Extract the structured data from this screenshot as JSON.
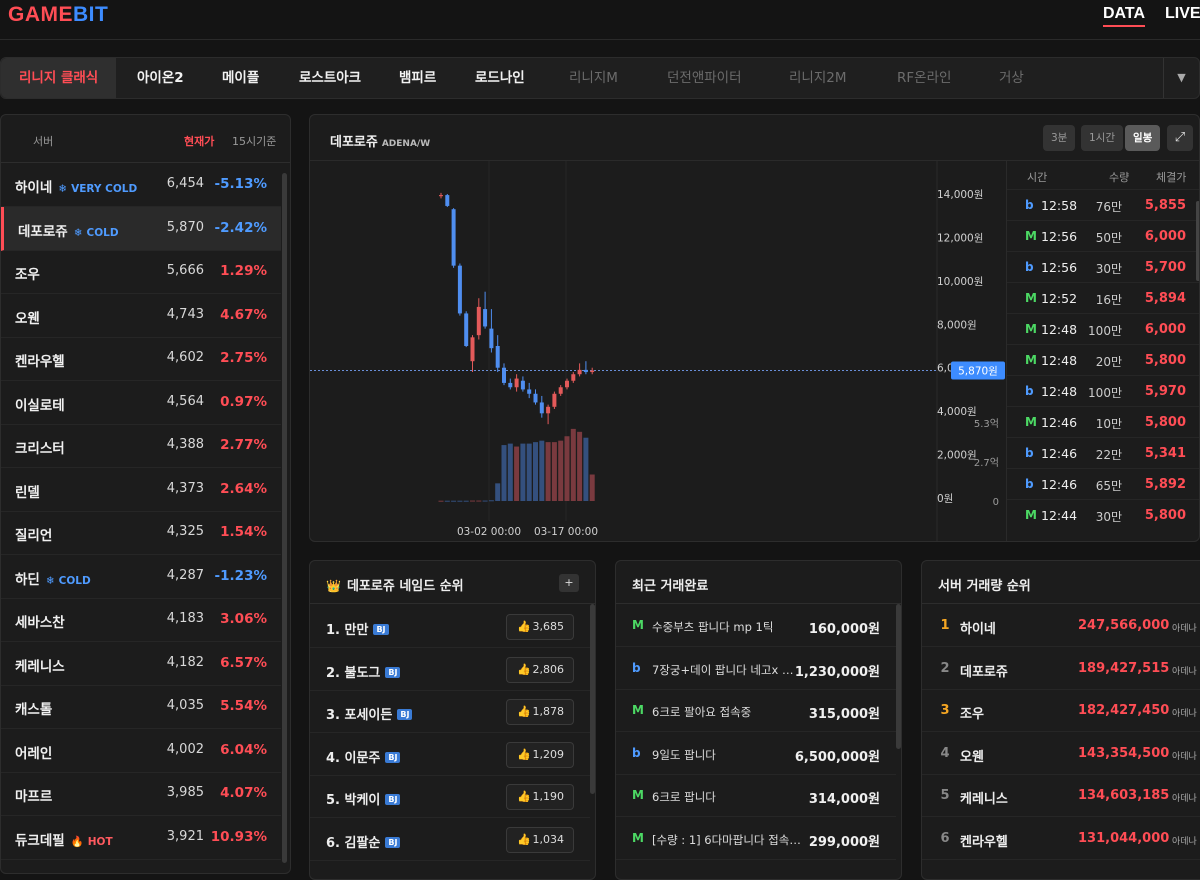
{
  "header": {
    "logo_part1": "GAME",
    "logo_part2": "BIT",
    "nav": [
      "DATA",
      "LIVE"
    ]
  },
  "game_tabs": {
    "items": [
      {
        "label": "리니지 클래식",
        "state": "active"
      },
      {
        "label": "아이온2",
        "state": "normal"
      },
      {
        "label": "메이플",
        "state": "normal"
      },
      {
        "label": "로스트아크",
        "state": "normal"
      },
      {
        "label": "뱀피르",
        "state": "normal"
      },
      {
        "label": "로드나인",
        "state": "normal"
      },
      {
        "label": "리니지M",
        "state": "dim"
      },
      {
        "label": "던전앤파이터",
        "state": "dim"
      },
      {
        "label": "리니지2M",
        "state": "dim"
      },
      {
        "label": "RF온라인",
        "state": "dim"
      },
      {
        "label": "거상",
        "state": "dim"
      }
    ],
    "more_icon": "▼"
  },
  "server_list": {
    "headers": {
      "server": "서버",
      "price": "현재가",
      "basis": "15시기준"
    },
    "rows": [
      {
        "name": "하이네",
        "tag": "VERY COLD",
        "tag_type": "cold",
        "price": "6,454",
        "change": "-5.13%",
        "dir": "dn",
        "selected": false
      },
      {
        "name": "데포로쥬",
        "tag": "COLD",
        "tag_type": "cold",
        "price": "5,870",
        "change": "-2.42%",
        "dir": "dn",
        "selected": true
      },
      {
        "name": "조우",
        "tag": "",
        "tag_type": "",
        "price": "5,666",
        "change": "1.29%",
        "dir": "up",
        "selected": false
      },
      {
        "name": "오웬",
        "tag": "",
        "tag_type": "",
        "price": "4,743",
        "change": "4.67%",
        "dir": "up",
        "selected": false
      },
      {
        "name": "켄라우헬",
        "tag": "",
        "tag_type": "",
        "price": "4,602",
        "change": "2.75%",
        "dir": "up",
        "selected": false
      },
      {
        "name": "이실로테",
        "tag": "",
        "tag_type": "",
        "price": "4,564",
        "change": "0.97%",
        "dir": "up",
        "selected": false
      },
      {
        "name": "크리스터",
        "tag": "",
        "tag_type": "",
        "price": "4,388",
        "change": "2.77%",
        "dir": "up",
        "selected": false
      },
      {
        "name": "린델",
        "tag": "",
        "tag_type": "",
        "price": "4,373",
        "change": "2.64%",
        "dir": "up",
        "selected": false
      },
      {
        "name": "질리언",
        "tag": "",
        "tag_type": "",
        "price": "4,325",
        "change": "1.54%",
        "dir": "up",
        "selected": false
      },
      {
        "name": "하딘",
        "tag": "COLD",
        "tag_type": "cold",
        "price": "4,287",
        "change": "-1.23%",
        "dir": "dn",
        "selected": false
      },
      {
        "name": "세바스찬",
        "tag": "",
        "tag_type": "",
        "price": "4,183",
        "change": "3.06%",
        "dir": "up",
        "selected": false
      },
      {
        "name": "케레니스",
        "tag": "",
        "tag_type": "",
        "price": "4,182",
        "change": "6.57%",
        "dir": "up",
        "selected": false
      },
      {
        "name": "캐스톨",
        "tag": "",
        "tag_type": "",
        "price": "4,035",
        "change": "5.54%",
        "dir": "up",
        "selected": false
      },
      {
        "name": "어레인",
        "tag": "",
        "tag_type": "",
        "price": "4,002",
        "change": "6.04%",
        "dir": "up",
        "selected": false
      },
      {
        "name": "마프르",
        "tag": "",
        "tag_type": "",
        "price": "3,985",
        "change": "4.07%",
        "dir": "up",
        "selected": false
      },
      {
        "name": "듀크데필",
        "tag": "HOT",
        "tag_type": "hot",
        "price": "3,921",
        "change": "10.93%",
        "dir": "up",
        "selected": false
      }
    ]
  },
  "chart_panel": {
    "title": "데포로쥬",
    "unit": "ADENA/W",
    "timeframes": [
      {
        "label": "3분",
        "on": false
      },
      {
        "label": "1시간",
        "on": false
      },
      {
        "label": "일봉",
        "on": true
      }
    ],
    "expand_icon": "⤢",
    "current_price_label": "5,870원"
  },
  "chart_data": {
    "type": "candlestick",
    "y_ticks": [
      "14,000원",
      "12,000원",
      "10,000원",
      "8,000원",
      "6,000원",
      "4,000원",
      "2,000원",
      "0원"
    ],
    "ylim": [
      0,
      14000
    ],
    "volume_ticks": [
      "5.3억",
      "2.7억",
      "0"
    ],
    "volume_lim": [
      0,
      5.3
    ],
    "x_ticks": [
      "03-02 00:00",
      "03-17 00:00"
    ],
    "current_price": 5870,
    "candles": [
      {
        "o": 13900,
        "h": 14050,
        "l": 13800,
        "c": 13950
      },
      {
        "o": 13950,
        "h": 14000,
        "l": 13400,
        "c": 13450
      },
      {
        "o": 13300,
        "h": 13350,
        "l": 10600,
        "c": 10700
      },
      {
        "o": 10700,
        "h": 10800,
        "l": 8400,
        "c": 8500
      },
      {
        "o": 8500,
        "h": 8600,
        "l": 6950,
        "c": 7000
      },
      {
        "o": 6300,
        "h": 7500,
        "l": 5800,
        "c": 7400
      },
      {
        "o": 7500,
        "h": 9200,
        "l": 7300,
        "c": 8800
      },
      {
        "o": 8700,
        "h": 9500,
        "l": 7800,
        "c": 7900
      },
      {
        "o": 7800,
        "h": 8700,
        "l": 6700,
        "c": 6900
      },
      {
        "o": 7000,
        "h": 7500,
        "l": 5800,
        "c": 6000
      },
      {
        "o": 6000,
        "h": 6200,
        "l": 5200,
        "c": 5300
      },
      {
        "o": 5300,
        "h": 5500,
        "l": 5000,
        "c": 5100
      },
      {
        "o": 5100,
        "h": 5700,
        "l": 4900,
        "c": 5500
      },
      {
        "o": 5400,
        "h": 5600,
        "l": 4900,
        "c": 5000
      },
      {
        "o": 5000,
        "h": 5300,
        "l": 4600,
        "c": 4800
      },
      {
        "o": 4800,
        "h": 5000,
        "l": 4300,
        "c": 4400
      },
      {
        "o": 4400,
        "h": 4700,
        "l": 3700,
        "c": 3900
      },
      {
        "o": 3900,
        "h": 4300,
        "l": 3400,
        "c": 4200
      },
      {
        "o": 4200,
        "h": 4900,
        "l": 4100,
        "c": 4800
      },
      {
        "o": 4800,
        "h": 5200,
        "l": 4700,
        "c": 5100
      },
      {
        "o": 5100,
        "h": 5500,
        "l": 5000,
        "c": 5400
      },
      {
        "o": 5400,
        "h": 5800,
        "l": 5300,
        "c": 5700
      },
      {
        "o": 5700,
        "h": 6200,
        "l": 5600,
        "c": 5900
      },
      {
        "o": 5900,
        "h": 6300,
        "l": 5700,
        "c": 5800
      },
      {
        "o": 5800,
        "h": 6000,
        "l": 5700,
        "c": 5870
      }
    ],
    "volume": [
      0.02,
      0.02,
      0.02,
      0.02,
      0.02,
      0.03,
      0.03,
      0.03,
      0.05,
      1.2,
      3.8,
      3.9,
      3.7,
      3.9,
      3.9,
      4.0,
      4.1,
      4.0,
      4.0,
      4.1,
      4.4,
      4.9,
      4.7,
      4.3,
      1.8
    ]
  },
  "trades_table": {
    "headers": {
      "time": "시간",
      "qty": "수량",
      "price": "체결가"
    },
    "rows": [
      {
        "platform": "b",
        "time": "12:58",
        "qty": "76만",
        "price": "5,855"
      },
      {
        "platform": "M",
        "time": "12:56",
        "qty": "50만",
        "price": "6,000"
      },
      {
        "platform": "b",
        "time": "12:56",
        "qty": "30만",
        "price": "5,700"
      },
      {
        "platform": "M",
        "time": "12:52",
        "qty": "16만",
        "price": "5,894"
      },
      {
        "platform": "M",
        "time": "12:48",
        "qty": "100만",
        "price": "6,000"
      },
      {
        "platform": "M",
        "time": "12:48",
        "qty": "20만",
        "price": "5,800"
      },
      {
        "platform": "b",
        "time": "12:48",
        "qty": "100만",
        "price": "5,970"
      },
      {
        "platform": "M",
        "time": "12:46",
        "qty": "10만",
        "price": "5,800"
      },
      {
        "platform": "b",
        "time": "12:46",
        "qty": "22만",
        "price": "5,341"
      },
      {
        "platform": "b",
        "time": "12:46",
        "qty": "65만",
        "price": "5,892"
      },
      {
        "platform": "M",
        "time": "12:44",
        "qty": "30만",
        "price": "5,800"
      }
    ]
  },
  "named_ranking": {
    "title": "데포로쥬 네임드 순위",
    "crown_icon": "👑",
    "add_label": "+",
    "like_icon": "👍",
    "rows": [
      {
        "name": "1. 만만",
        "badge": "BJ",
        "likes": "3,685"
      },
      {
        "name": "2. 불도그",
        "badge": "BJ",
        "likes": "2,806"
      },
      {
        "name": "3. 포세이든",
        "badge": "BJ",
        "likes": "1,878"
      },
      {
        "name": "4. 이문주",
        "badge": "BJ",
        "likes": "1,209"
      },
      {
        "name": "5. 박케이",
        "badge": "BJ",
        "likes": "1,190"
      },
      {
        "name": "6. 김팔순",
        "badge": "BJ",
        "likes": "1,034"
      }
    ]
  },
  "recent_trades": {
    "title": "최근 거래완료",
    "rows": [
      {
        "platform": "M",
        "text": "수중부츠 팝니다 mp 1틱",
        "price": "160,000원"
      },
      {
        "platform": "b",
        "text": "7장궁+데이 팝니다 네고x 접...",
        "price": "1,230,000원"
      },
      {
        "platform": "M",
        "text": "6크로 팔아요 접속중",
        "price": "315,000원"
      },
      {
        "platform": "b",
        "text": "9일도 팝니다",
        "price": "6,500,000원"
      },
      {
        "platform": "M",
        "text": "6크로 팝니다",
        "price": "314,000원"
      },
      {
        "platform": "M",
        "text": "[수량 : 1] 6다마팝니다 접속중 ...",
        "price": "299,000원"
      }
    ]
  },
  "server_volume": {
    "title": "서버 거래량 순위",
    "unit": "아데나",
    "rows": [
      {
        "rank": "1",
        "name": "하이네",
        "value": "247,566,000",
        "gold": true
      },
      {
        "rank": "2",
        "name": "데포로쥬",
        "value": "189,427,515",
        "gold": false
      },
      {
        "rank": "3",
        "name": "조우",
        "value": "182,427,450",
        "gold": true
      },
      {
        "rank": "4",
        "name": "오웬",
        "value": "143,354,500",
        "gold": false
      },
      {
        "rank": "5",
        "name": "케레니스",
        "value": "134,603,185",
        "gold": false
      },
      {
        "rank": "6",
        "name": "켄라우헬",
        "value": "131,044,000",
        "gold": false
      }
    ]
  },
  "colors": {
    "up": "#ff4d55",
    "down": "#4f9bff",
    "accent": "#ff4d55",
    "bj_badge": "#3a7bd5"
  }
}
